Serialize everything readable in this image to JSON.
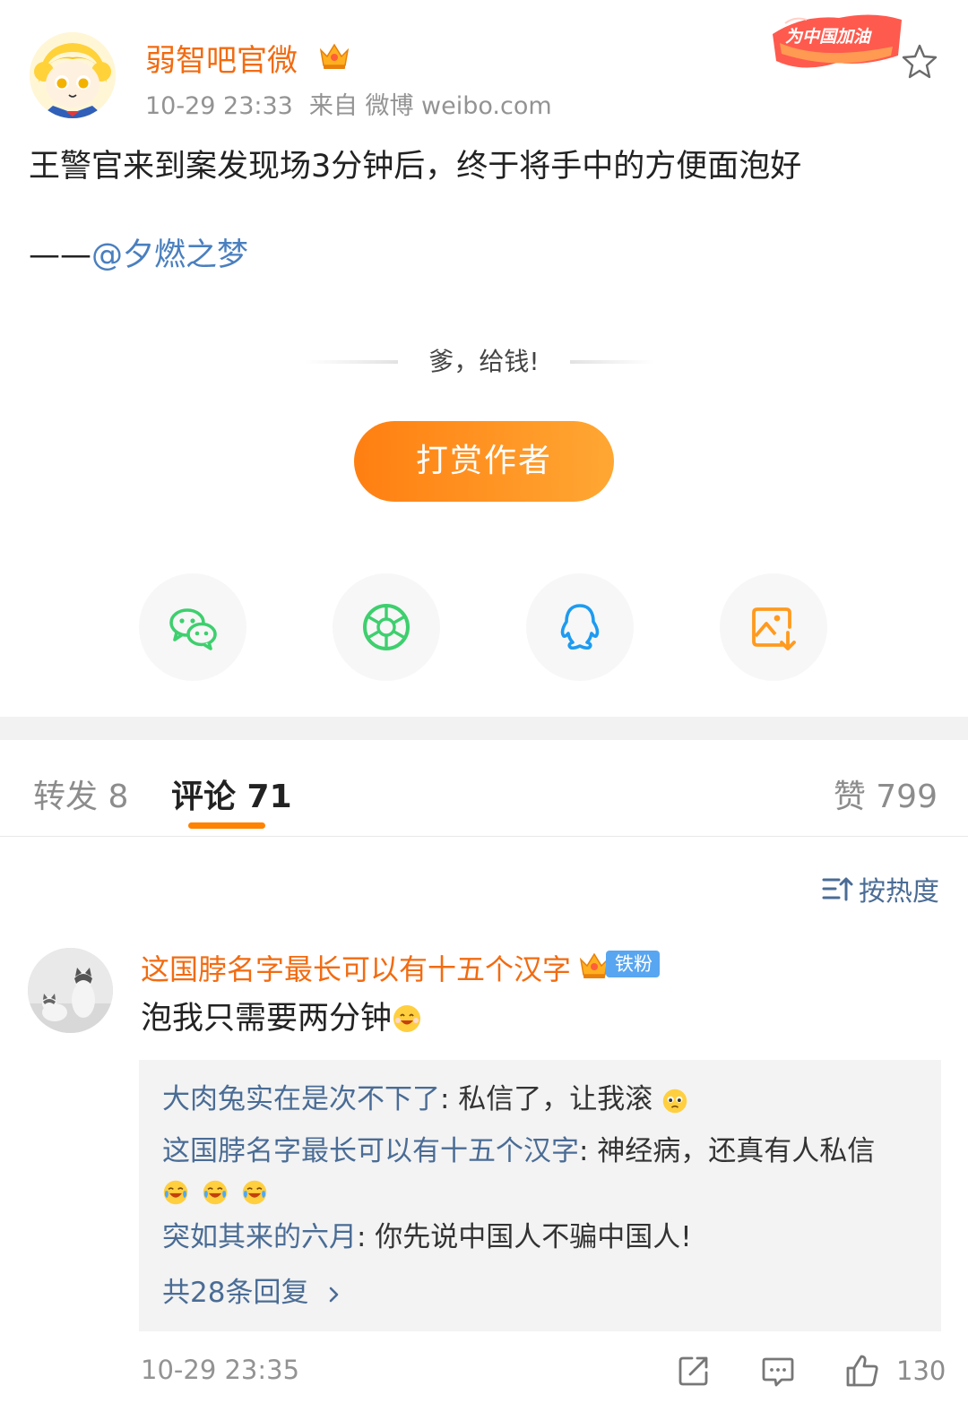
{
  "post": {
    "author": "弱智吧官微",
    "time": "10-29 23:33",
    "source": "来自 微博 weibo.com",
    "campaign_text": "为中国加油",
    "content": "王警官来到案发现场3分钟后，终于将手中的方便面泡好",
    "credit_prefix": "——",
    "credit_mention": "@夕燃之梦",
    "reward_prompt": "爹，给钱!",
    "reward_button": "打赏作者"
  },
  "share": {
    "icons": [
      "wechat-icon",
      "moments-icon",
      "qq-icon",
      "save-image-icon"
    ]
  },
  "tabs": {
    "repost": "转发 8",
    "comments": "评论 71",
    "likes": "赞 799"
  },
  "sort": {
    "label": "按热度"
  },
  "comment": {
    "user": "这国脖名字最长可以有十五个汉字",
    "badge": "铁粉",
    "text": "泡我只需要两分钟",
    "replies": [
      {
        "user": "大肉兔实在是次不下了",
        "text": ": 私信了，让我滚"
      },
      {
        "user": "这国脖名字最长可以有十五个汉字",
        "text": ": 神经病，还真有人私信"
      },
      {
        "user": "突如其来的六月",
        "text": ": 你先说中国人不骗中国人!"
      }
    ],
    "more_replies": "共28条回复",
    "time": "10-29 23:35",
    "like_count": "130"
  },
  "colors": {
    "accent_orange": "#ff8200",
    "username_orange": "#f26b11",
    "link_blue": "#4a6c95",
    "wechat_green": "#3ecf6e",
    "qq_blue": "#1e9bf0",
    "save_orange": "#ff9a1f"
  }
}
